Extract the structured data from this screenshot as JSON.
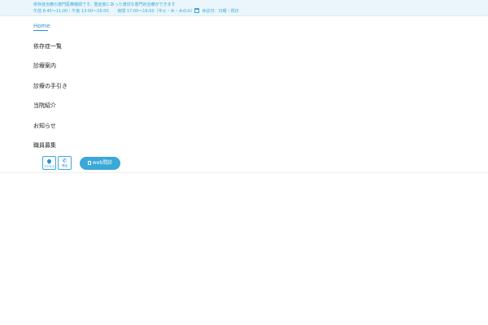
{
  "topbar": {
    "tagline": "依存症治療の専門医療機関です。重症度にあった適切な専門的治療ができます",
    "hours_day": "午前 8:45～11:00｜午後 13:00～16:00",
    "hours_evening": "夜間 17:00～19:00（半火・木・木のみ）",
    "holiday": "休診日：日曜・祝日",
    "calendar_icon": "calendar-icon"
  },
  "nav": {
    "home": "Home",
    "items": [
      "依存症一覧",
      "診療案内",
      "診療の手引き",
      "当院紹介",
      "お知らせ",
      "職員募集"
    ]
  },
  "actions": {
    "access_label": "アクセス",
    "access_icon": "map-pin-icon",
    "phone_label": "電話",
    "phone_icon": "phone-icon",
    "web_label": "web問診",
    "web_icon": "document-icon"
  },
  "colors": {
    "accent": "#3aa8d8",
    "link": "#2f8fd0",
    "topbar_bg": "#eaf6fb",
    "text": "#222222"
  }
}
